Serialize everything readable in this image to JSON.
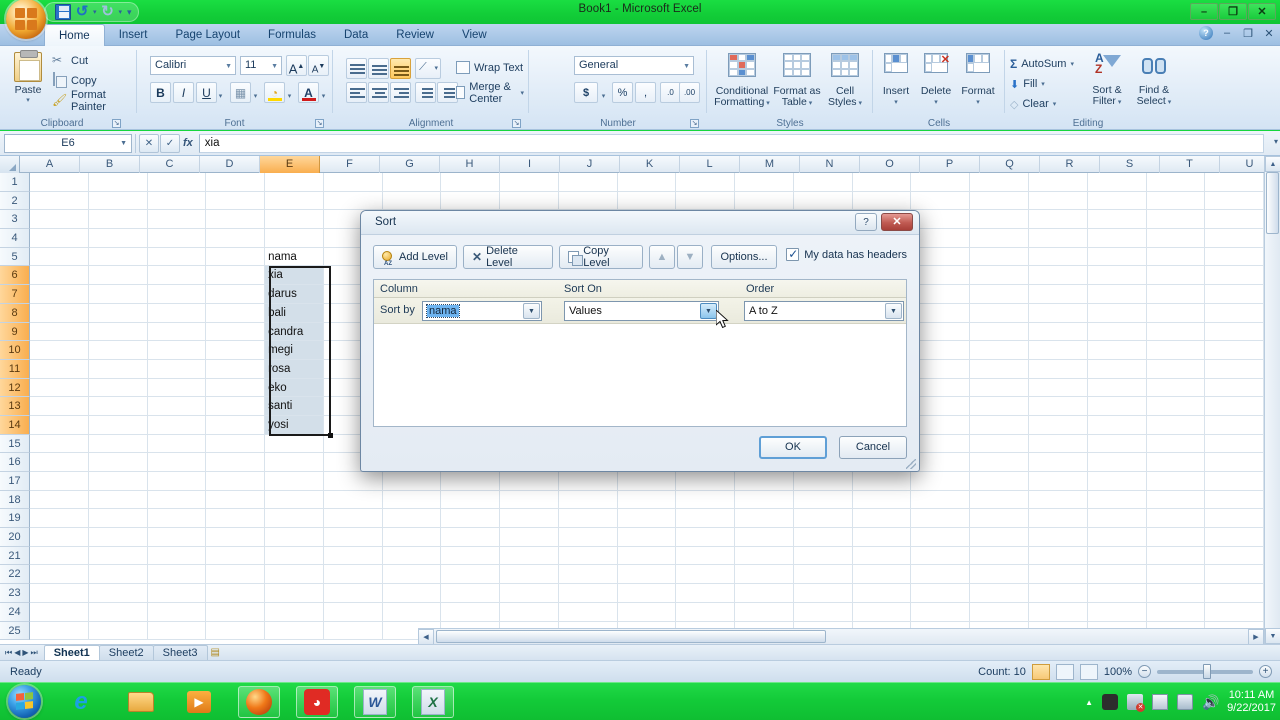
{
  "window": {
    "title": "Book1 - Microsoft Excel",
    "minimize": "–",
    "restore": "❐",
    "close": "✕"
  },
  "quick_access": {
    "save": "save-icon",
    "undo": "↺",
    "redo": "↻",
    "customize": "▾"
  },
  "ribbon": {
    "tabs": [
      {
        "label": "Home",
        "active": true
      },
      {
        "label": "Insert",
        "active": false
      },
      {
        "label": "Page Layout",
        "active": false
      },
      {
        "label": "Formulas",
        "active": false
      },
      {
        "label": "Data",
        "active": false
      },
      {
        "label": "Review",
        "active": false
      },
      {
        "label": "View",
        "active": false
      }
    ],
    "doc_controls": {
      "help": "?",
      "minimize": "–",
      "restore": "❐",
      "close": "✕"
    },
    "clipboard": {
      "group_label": "Clipboard",
      "paste": "Paste",
      "cut": "Cut",
      "copy": "Copy",
      "format_painter": "Format Painter"
    },
    "font": {
      "group_label": "Font",
      "font_name": "Calibri",
      "font_size": "11",
      "grow_font": "A",
      "shrink_font": "A",
      "bold": "B",
      "italic": "I",
      "underline": "U",
      "borders": "▦",
      "fill_color": "A",
      "font_color": "A"
    },
    "alignment": {
      "group_label": "Alignment",
      "wrap_text": "Wrap Text",
      "merge_center": "Merge & Center"
    },
    "number": {
      "group_label": "Number",
      "format": "General",
      "currency": "$",
      "percent": "%",
      "comma": ",",
      "increase_decimal": ".0",
      "decrease_decimal": ".00"
    },
    "styles": {
      "group_label": "Styles",
      "conditional_formatting": "Conditional Formatting",
      "format_as_table": "Format as Table",
      "cell_styles": "Cell Styles"
    },
    "cells": {
      "group_label": "Cells",
      "insert": "Insert",
      "delete": "Delete",
      "format": "Format"
    },
    "editing": {
      "group_label": "Editing",
      "autosum": "AutoSum",
      "fill": "Fill",
      "clear": "Clear",
      "sort_filter": "Sort & Filter",
      "find_select": "Find & Select"
    }
  },
  "formula_bar": {
    "name_box": "E6",
    "fx_label": "fx",
    "cancel": "✕",
    "enter": "✓",
    "value": "xia",
    "expand": "▾"
  },
  "grid": {
    "columns": [
      "A",
      "B",
      "C",
      "D",
      "E",
      "F",
      "G",
      "H",
      "I",
      "J",
      "K",
      "L",
      "M",
      "N",
      "O",
      "P",
      "Q",
      "R",
      "S",
      "T",
      "U"
    ],
    "selected_column": "E",
    "rows": [
      "1",
      "2",
      "3",
      "4",
      "5",
      "6",
      "7",
      "8",
      "9",
      "10",
      "11",
      "12",
      "13",
      "14",
      "15",
      "16",
      "17",
      "18",
      "19",
      "20",
      "21",
      "22",
      "23",
      "24",
      "25"
    ],
    "selected_rows": [
      "6",
      "7",
      "8",
      "9",
      "10",
      "11",
      "12",
      "13",
      "14"
    ],
    "column_e_values": {
      "5": "nama",
      "6": "xia",
      "7": "darus",
      "8": "bali",
      "9": "candra",
      "10": "megi",
      "11": "rosa",
      "12": "eko",
      "13": "santi",
      "14": "yosi"
    },
    "selection_range": "E6:E14"
  },
  "sheet_tabs": {
    "first": "⏮",
    "prev": "◀",
    "next": "▶",
    "last": "⏭",
    "tabs": [
      {
        "label": "Sheet1",
        "active": true
      },
      {
        "label": "Sheet2",
        "active": false
      },
      {
        "label": "Sheet3",
        "active": false
      }
    ],
    "insert_sheet": "insert-worksheet-icon"
  },
  "status_bar": {
    "mode": "Ready",
    "count": "Count: 10",
    "view_normal": "normal-view-icon",
    "view_page_layout": "page-layout-view-icon",
    "view_page_break": "page-break-view-icon",
    "zoom": "100%",
    "zoom_out": "−",
    "zoom_in": "+"
  },
  "sort_dialog": {
    "title": "Sort",
    "help_button": "?",
    "close_button": "✕",
    "add_level": "Add Level",
    "delete_level": "Delete Level",
    "copy_level": "Copy Level",
    "move_up": "▲",
    "move_down": "▼",
    "options": "Options...",
    "my_data_has_headers": "My data has headers",
    "headers_checked": true,
    "col_header_column": "Column",
    "col_header_sort_on": "Sort On",
    "col_header_order": "Order",
    "sort_by_label": "Sort by",
    "sort_by_value": "nama",
    "sort_on_value": "Values",
    "order_value": "A to Z",
    "dropdown_arrow": "▼",
    "ok": "OK",
    "cancel": "Cancel"
  },
  "taskbar": {
    "start": "start-orb",
    "items": [
      {
        "name": "internet-explorer-icon",
        "open": false
      },
      {
        "name": "windows-explorer-icon",
        "open": false
      },
      {
        "name": "windows-media-player-icon",
        "open": false
      },
      {
        "name": "firefox-icon",
        "open": true
      },
      {
        "name": "gom-player-icon",
        "open": true
      },
      {
        "name": "microsoft-word-icon",
        "open": true
      },
      {
        "name": "microsoft-excel-icon",
        "open": true
      }
    ],
    "tray": {
      "show_hidden": "▲",
      "network": "",
      "action_center": "",
      "volume": ""
    },
    "time": "10:11 AM",
    "date": "9/22/2017"
  }
}
